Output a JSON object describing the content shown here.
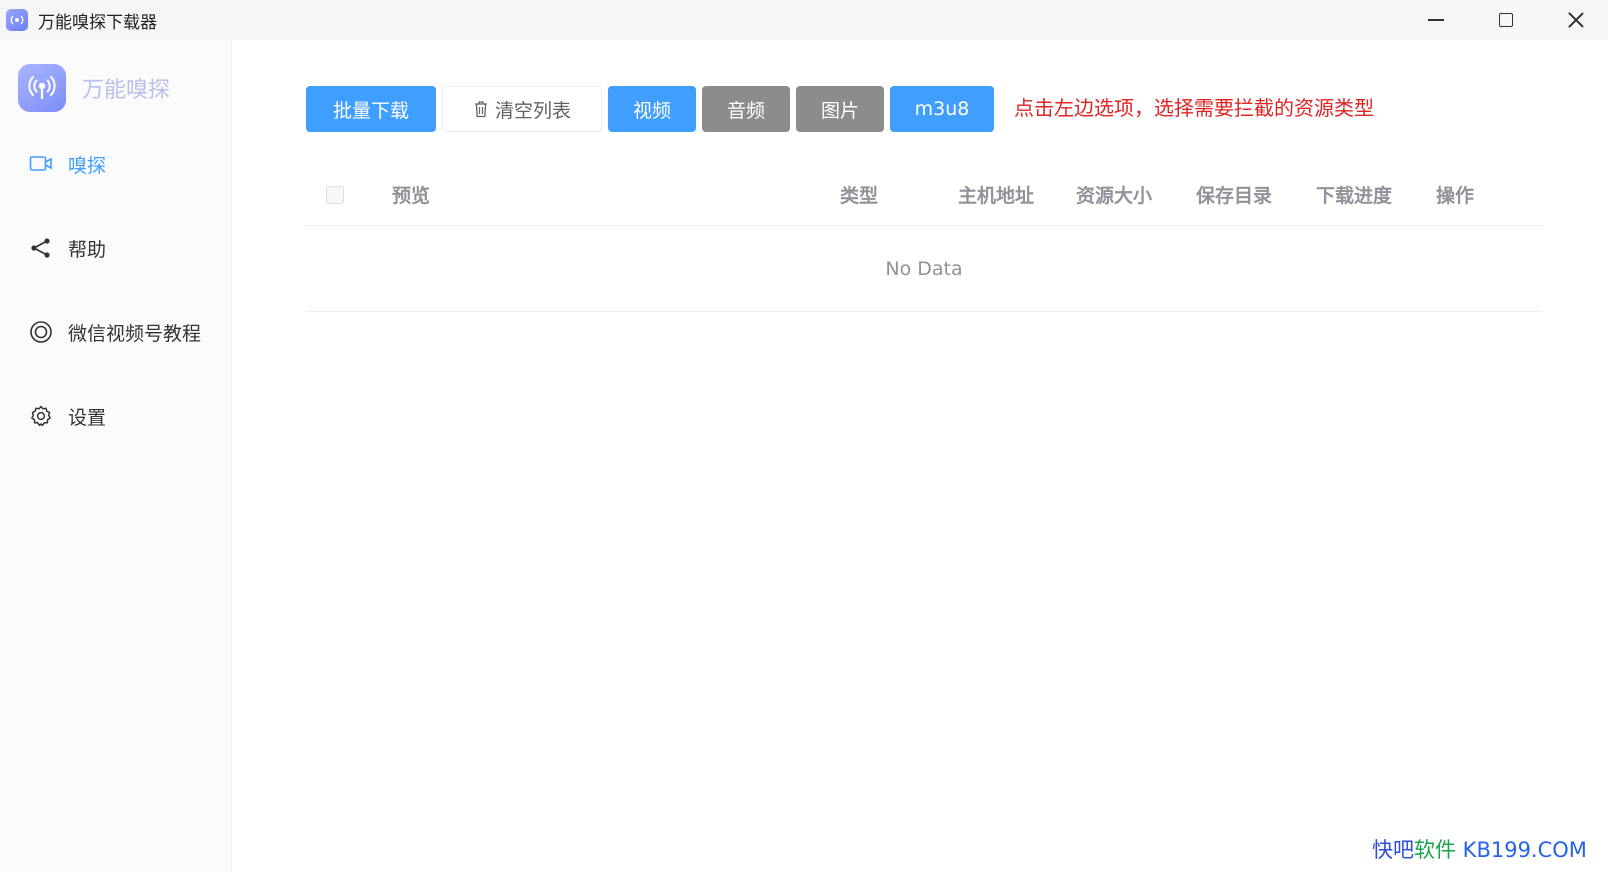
{
  "window": {
    "title": "万能嗅探下载器"
  },
  "sidebar": {
    "brand_name": "万能嗅探",
    "items": [
      {
        "label": "嗅探",
        "icon": "video-camera-icon",
        "active": true
      },
      {
        "label": "帮助",
        "icon": "share-icon",
        "active": false
      },
      {
        "label": "微信视频号教程",
        "icon": "circle-icon",
        "active": false
      },
      {
        "label": "设置",
        "icon": "gear-icon",
        "active": false
      }
    ]
  },
  "toolbar": {
    "batch_download": "批量下载",
    "clear_list": "清空列表",
    "filters": [
      {
        "label": "视频",
        "selected": true
      },
      {
        "label": "音频",
        "selected": false
      },
      {
        "label": "图片",
        "selected": false
      },
      {
        "label": "m3u8",
        "selected": true
      }
    ],
    "hint": "点击左边选项，选择需要拦截的资源类型"
  },
  "table": {
    "columns": [
      "预览",
      "类型",
      "主机地址",
      "资源大小",
      "保存目录",
      "下载进度",
      "操作"
    ],
    "rows": [],
    "empty_text": "No Data"
  },
  "watermark": {
    "part_a": "快吧",
    "part_b": "软件",
    "part_c": " KB199.COM"
  },
  "colors": {
    "primary": "#409eff",
    "gray_button": "#8c8c8c",
    "hint_red": "#e02424"
  }
}
